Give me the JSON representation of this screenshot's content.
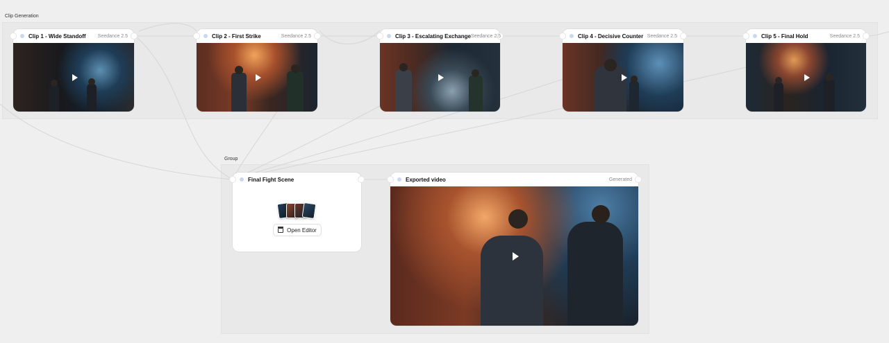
{
  "groups": {
    "clip_generation": {
      "label": "Clip Generation"
    },
    "group": {
      "label": "Group"
    }
  },
  "clips": [
    {
      "title": "Clip 1 - Wide Standoff",
      "model": "Seedance 2.5",
      "icon": "play-icon"
    },
    {
      "title": "Clip 2 - First Strike",
      "model": "Seedance 2.5",
      "icon": "play-icon"
    },
    {
      "title": "Clip 3 - Escalating Exchange",
      "model": "Seedance 2.5",
      "icon": "play-icon"
    },
    {
      "title": "Clip 4 - Decisive Counter",
      "model": "Seedance 2.5",
      "icon": "play-icon"
    },
    {
      "title": "Clip 5 - Final Hold",
      "model": "Seedance 2.5",
      "icon": "play-icon"
    }
  ],
  "final_scene": {
    "title": "Final Fight Scene",
    "open_editor_label": "Open Editor",
    "icon": "clapperboard-icon"
  },
  "exported": {
    "title": "Exported video",
    "status": "Generated",
    "icon": "play-icon"
  },
  "colors": {
    "canvas": "#efefef",
    "node": "#ffffff",
    "accent_dot": "#c9d8f2",
    "brick": "#8a4630",
    "alley_blue": "#1f3d57"
  }
}
